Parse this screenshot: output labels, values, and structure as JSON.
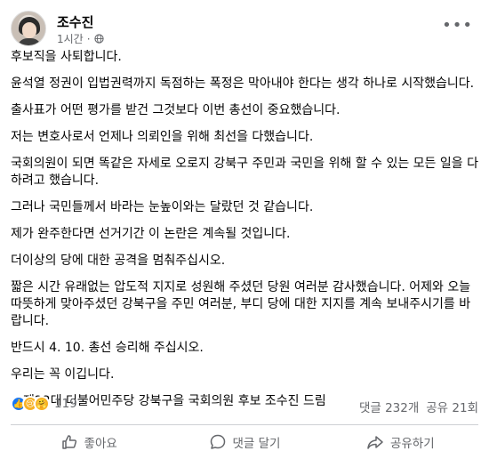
{
  "post": {
    "author": "조수진",
    "time": "1시간",
    "separator": "·",
    "paragraphs": [
      "후보직을 사퇴합니다.",
      "윤석열 정권이 입법권력까지 독점하는 폭정은 막아내야 한다는 생각 하나로 시작했습니다.",
      "출사표가 어떤 평가를 받건 그것보다 이번 총선이 중요했습니다.",
      "저는 변호사로서 언제나 의뢰인을 위해 최선을 다했습니다.",
      "국회의원이 되면 똑같은 자세로 오로지 강북구 주민과 국민을 위해 할 수 있는 모든 일을 다하려고 했습니다.",
      "그러나 국민들께서 바라는 눈높이와는 달랐던 것 같습니다.",
      "제가 완주한다면 선거기간 이 논란은 계속될 것입니다.",
      "더이상의 당에 대한 공격을 멈춰주십시오.",
      "짧은 시간 유래없는 압도적 지지로 성원해 주셨던 당원 여러분 감사했습니다. 어제와 오늘 따뜻하게 맞아주셨던 강북구을 주민 여러분, 부디 당에 대한 지지를 계속 보내주시기를 바랍니다.",
      "반드시 4. 10. 총선 승리해 주십시오.",
      "우리는 꼭 이깁니다.",
      "—제22대 더불어민주당 강북구을 국회의원 후보 조수진 드림"
    ]
  },
  "stats": {
    "reaction_count": "119",
    "comments": "댓글 232개",
    "shares": "공유 21회"
  },
  "actions": {
    "like": "좋아요",
    "comment": "댓글 달기",
    "share": "공유하기"
  },
  "icons": {
    "privacy": "globe-icon",
    "more": "more-options-icon",
    "reactions": [
      "like-reaction-icon",
      "sad-reaction-icon",
      "care-reaction-icon"
    ]
  },
  "colors": {
    "brand": "#1877f2",
    "secondary_text": "#65676b"
  }
}
